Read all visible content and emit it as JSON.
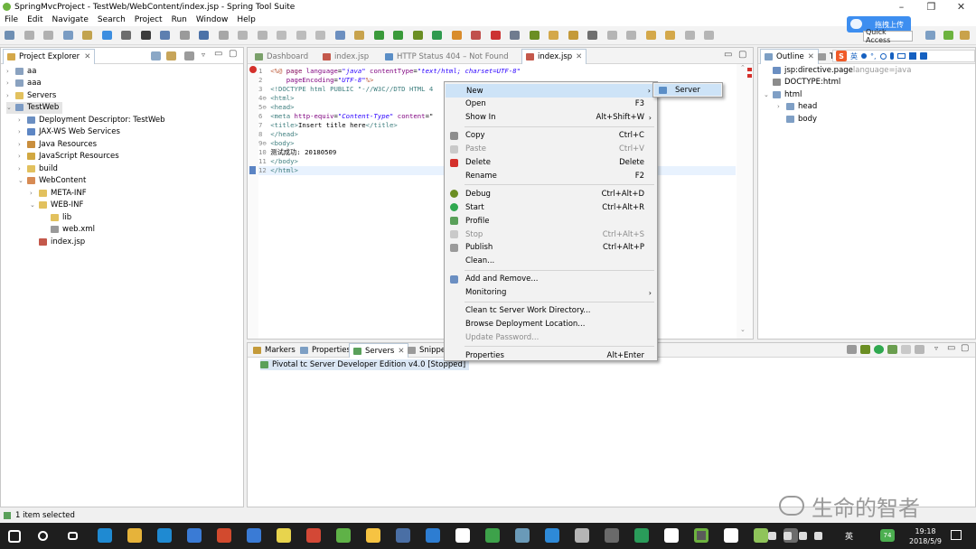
{
  "window": {
    "title": "SpringMvcProject - TestWeb/WebContent/index.jsp - Spring Tool Suite"
  },
  "menubar": [
    "File",
    "Edit",
    "Navigate",
    "Search",
    "Project",
    "Run",
    "Window",
    "Help"
  ],
  "toolbar": {
    "quick_access": "Quick Access",
    "upload_badge": "拖拽上传"
  },
  "project_explorer": {
    "title": "Project Explorer",
    "items": [
      {
        "label": "aa",
        "level": 0,
        "arrow": "›",
        "icon": "project-icon"
      },
      {
        "label": "aaa",
        "level": 0,
        "arrow": "›",
        "icon": "project-icon"
      },
      {
        "label": "Servers",
        "level": 0,
        "arrow": "›",
        "icon": "folder-icon"
      },
      {
        "label": "TestWeb",
        "level": 0,
        "arrow": "⌄",
        "icon": "web-project-icon",
        "selected": true
      },
      {
        "label": "Deployment Descriptor: TestWeb",
        "level": 1,
        "arrow": "›",
        "icon": "descriptor-icon"
      },
      {
        "label": "JAX-WS Web Services",
        "level": 1,
        "arrow": "›",
        "icon": "webservice-icon"
      },
      {
        "label": "Java Resources",
        "level": 1,
        "arrow": "›",
        "icon": "java-resources-icon"
      },
      {
        "label": "JavaScript Resources",
        "level": 1,
        "arrow": "›",
        "icon": "js-resources-icon"
      },
      {
        "label": "build",
        "level": 1,
        "arrow": "›",
        "icon": "folder-icon"
      },
      {
        "label": "WebContent",
        "level": 1,
        "arrow": "⌄",
        "icon": "webcontent-folder-icon"
      },
      {
        "label": "META-INF",
        "level": 2,
        "arrow": "›",
        "icon": "folder-icon"
      },
      {
        "label": "WEB-INF",
        "level": 2,
        "arrow": "⌄",
        "icon": "folder-icon"
      },
      {
        "label": "lib",
        "level": 3,
        "arrow": "",
        "icon": "folder-icon"
      },
      {
        "label": "web.xml",
        "level": 3,
        "arrow": "",
        "icon": "xml-file-icon"
      },
      {
        "label": "index.jsp",
        "level": 2,
        "arrow": "",
        "icon": "jsp-file-icon"
      }
    ]
  },
  "editor": {
    "tabs": [
      "Dashboard",
      "index.jsp",
      "HTTP Status 404 – Not Found",
      "index.jsp"
    ],
    "active_tab": 3,
    "lines": [
      {
        "n": "1",
        "parts": [
          [
            "dir",
            "<%@ "
          ],
          [
            "kw",
            "page "
          ],
          [
            "attr",
            "language"
          ],
          [
            "",
            "="
          ],
          [
            "str",
            "\"java\""
          ],
          [
            "attr",
            " contentType"
          ],
          [
            "",
            "="
          ],
          [
            "str",
            "\"text/html; charset=UTF-8\""
          ]
        ]
      },
      {
        "n": "2",
        "parts": [
          [
            "attr",
            "    pageEncoding"
          ],
          [
            "",
            "="
          ],
          [
            "str",
            "\"UTF-8\""
          ],
          [
            "dir",
            "%>"
          ]
        ]
      },
      {
        "n": "3",
        "parts": [
          [
            "tag",
            "<!DOCTYPE html PUBLIC \"-//W3C//DTD HTML 4"
          ]
        ]
      },
      {
        "n": "4⊖",
        "parts": [
          [
            "tag",
            "<html>"
          ]
        ]
      },
      {
        "n": "5⊖",
        "parts": [
          [
            "tag",
            "<head>"
          ]
        ]
      },
      {
        "n": "6",
        "parts": [
          [
            "tag",
            "<meta "
          ],
          [
            "attr",
            "http-equiv"
          ],
          [
            "",
            "="
          ],
          [
            "str",
            "\"Content-Type\""
          ],
          [
            "attr",
            " content"
          ],
          [
            "",
            "=\""
          ]
        ]
      },
      {
        "n": "7",
        "parts": [
          [
            "tag",
            "<title>"
          ],
          [
            "",
            "Insert title here"
          ],
          [
            "tag",
            "</title>"
          ]
        ]
      },
      {
        "n": "8",
        "parts": [
          [
            "tag",
            "</head>"
          ]
        ]
      },
      {
        "n": "9⊖",
        "parts": [
          [
            "tag",
            "<body>"
          ]
        ]
      },
      {
        "n": "10",
        "parts": [
          [
            "",
            "测试成功: 20180509"
          ]
        ]
      },
      {
        "n": "11",
        "parts": [
          [
            "tag",
            "</body>"
          ]
        ]
      },
      {
        "n": "12",
        "parts": [
          [
            "tag",
            "</html>"
          ]
        ]
      }
    ]
  },
  "outline": {
    "tabs": [
      "Outline",
      "Ta"
    ],
    "items": [
      {
        "label": "jsp:directive.page",
        "suffix": " language=java",
        "level": 0,
        "arrow": "",
        "icon": "directive-icon"
      },
      {
        "label": "DOCTYPE:html",
        "level": 0,
        "arrow": "",
        "icon": "doctype-icon"
      },
      {
        "label": "html",
        "level": 0,
        "arrow": "⌄",
        "icon": "element-icon"
      },
      {
        "label": "head",
        "level": 1,
        "arrow": "›",
        "icon": "element-icon"
      },
      {
        "label": "body",
        "level": 1,
        "arrow": "",
        "icon": "element-icon"
      }
    ]
  },
  "bottom_panel": {
    "tabs": [
      "Markers",
      "Properties",
      "Servers",
      "Snippe"
    ],
    "active_tab": 2,
    "server_row": "Pivotal tc Server Developer Edition v4.0  [Stopped]"
  },
  "context_menu": {
    "items": [
      {
        "label": "New",
        "acc": "",
        "sub": true,
        "highlight": true,
        "icon": ""
      },
      {
        "label": "Open",
        "acc": "F3",
        "icon": ""
      },
      {
        "label": "Show In",
        "acc": "Alt+Shift+W",
        "sub": true,
        "icon": ""
      },
      {
        "sep": true
      },
      {
        "label": "Copy",
        "acc": "Ctrl+C",
        "icon": "copy-icon"
      },
      {
        "label": "Paste",
        "acc": "Ctrl+V",
        "disabled": true,
        "icon": "paste-icon"
      },
      {
        "label": "Delete",
        "acc": "Delete",
        "icon": "delete-icon"
      },
      {
        "label": "Rename",
        "acc": "F2",
        "icon": ""
      },
      {
        "sep": true
      },
      {
        "label": "Debug",
        "acc": "Ctrl+Alt+D",
        "icon": "debug-icon"
      },
      {
        "label": "Start",
        "acc": "Ctrl+Alt+R",
        "icon": "start-icon"
      },
      {
        "label": "Profile",
        "acc": "",
        "icon": "profile-icon"
      },
      {
        "label": "Stop",
        "acc": "Ctrl+Alt+S",
        "disabled": true,
        "icon": "stop-icon"
      },
      {
        "label": "Publish",
        "acc": "Ctrl+Alt+P",
        "icon": "publish-icon"
      },
      {
        "label": "Clean...",
        "acc": "",
        "icon": ""
      },
      {
        "sep": true
      },
      {
        "label": "Add and Remove...",
        "acc": "",
        "icon": "add-remove-icon"
      },
      {
        "label": "Monitoring",
        "acc": "",
        "sub": true,
        "icon": ""
      },
      {
        "sep": true
      },
      {
        "label": "Clean tc Server Work Directory...",
        "acc": "",
        "icon": ""
      },
      {
        "label": "Browse Deployment Location...",
        "acc": "",
        "icon": ""
      },
      {
        "label": "Update Password...",
        "acc": "",
        "disabled": true,
        "icon": ""
      },
      {
        "sep": true
      },
      {
        "label": "Properties",
        "acc": "Alt+Enter",
        "icon": ""
      }
    ]
  },
  "submenu": {
    "label": "Server"
  },
  "statusbar": {
    "text": "1 item selected"
  },
  "watermark": {
    "text": "生命的智者"
  },
  "taskbar": {
    "time": "19:18",
    "date": "2018/5/9",
    "ime": "英",
    "badge": "74"
  }
}
